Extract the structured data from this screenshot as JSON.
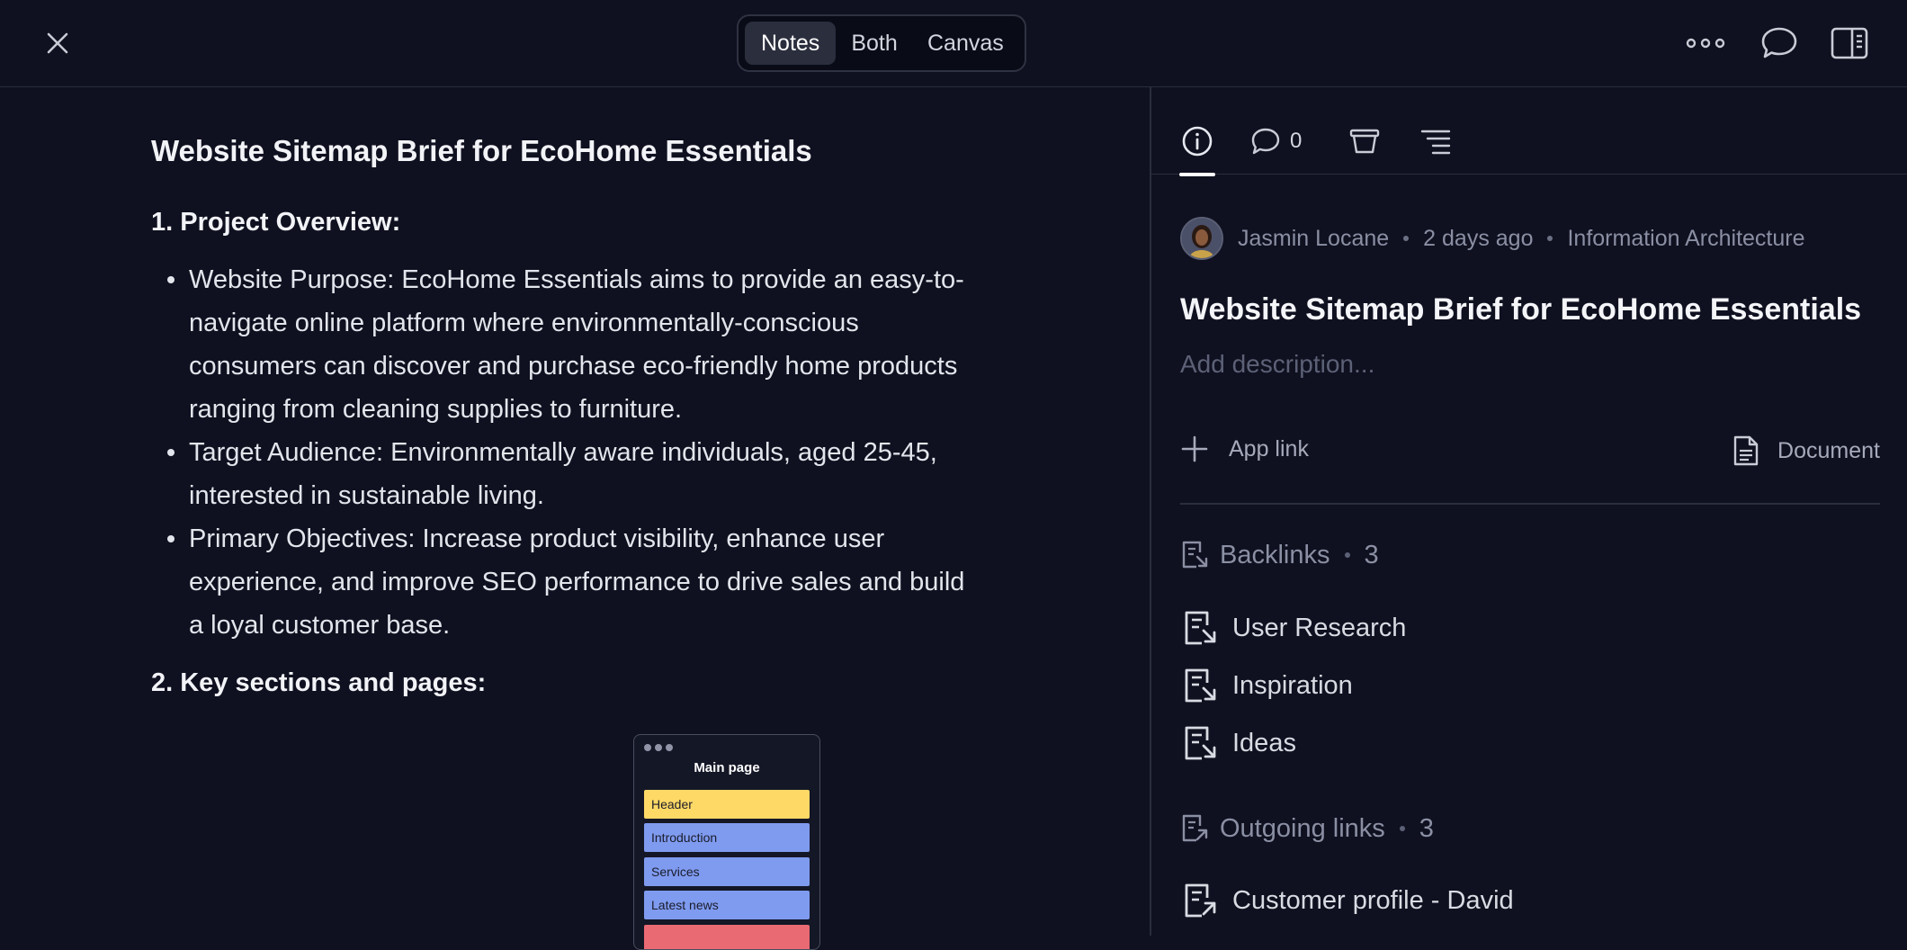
{
  "view_switcher": {
    "options": [
      "Notes",
      "Both",
      "Canvas"
    ],
    "active": "Notes"
  },
  "notes": {
    "title": "Website Sitemap Brief for EcoHome Essentials",
    "section1_heading": "1. Project Overview:",
    "bullets": [
      "Website Purpose: EcoHome Essentials aims to provide an easy-to-navigate online platform where environmentally-conscious consumers can discover and purchase eco-friendly home products ranging from cleaning supplies to furniture.",
      "Target Audience: Environmentally aware individuals, aged 25-45, interested in sustainable living.",
      "Primary Objectives: Increase product visibility, enhance user experience, and improve SEO performance to drive sales and build a loyal customer base."
    ],
    "section2_heading": "2. Key sections and pages:",
    "sitemap": {
      "title": "Main page",
      "blocks": [
        "Header",
        "Introduction",
        "Services",
        "Latest news",
        ""
      ],
      "colors": {
        "header": "#ffd966",
        "section": "#7f9bf0",
        "footer": "#ea6a73"
      }
    }
  },
  "panel": {
    "comment_count": "0",
    "author": "Jasmin Locane",
    "time": "2 days ago",
    "category": "Information Architecture",
    "title": "Website Sitemap Brief for EcoHome Essentials",
    "description_placeholder": "Add description...",
    "app_link_label": "App link",
    "document_label": "Document",
    "backlinks": {
      "label": "Backlinks",
      "count": "3",
      "items": [
        "User Research",
        "Inspiration",
        "Ideas"
      ]
    },
    "outgoing": {
      "label": "Outgoing links",
      "count": "3",
      "items": [
        "Customer profile - David"
      ]
    }
  },
  "icons": [
    "close-icon",
    "more-icon",
    "chat-icon",
    "panel-icon",
    "info-icon",
    "comment-icon",
    "trash-icon",
    "outline-icon",
    "plus-icon",
    "document-icon",
    "backlink-icon",
    "outgoing-link-icon"
  ]
}
